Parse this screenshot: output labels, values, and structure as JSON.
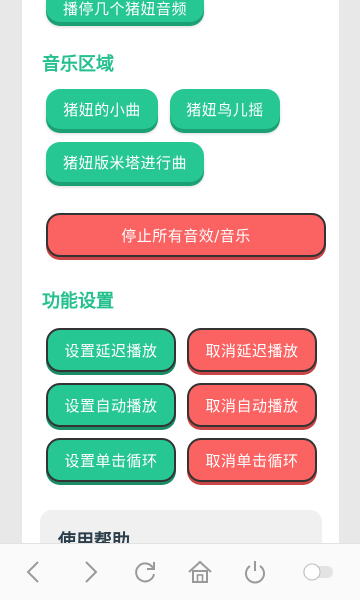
{
  "top_partial_button": {
    "label": "播停几个猪妞音频"
  },
  "music_section": {
    "title": "音乐区域",
    "buttons": [
      "猪妞的小曲",
      "猪妞鸟儿摇",
      "猪妞版米塔进行曲"
    ]
  },
  "stop_all": {
    "label": "停止所有音效/音乐"
  },
  "settings_section": {
    "title": "功能设置",
    "rows": [
      {
        "set": "设置延迟播放",
        "cancel": "取消延迟播放"
      },
      {
        "set": "设置自动播放",
        "cancel": "取消自动播放"
      },
      {
        "set": "设置单击循环",
        "cancel": "取消单击循环"
      }
    ]
  },
  "help": {
    "title": "使用帮助"
  },
  "nav_bar": {
    "icons": [
      "back-icon",
      "forward-icon",
      "refresh-icon",
      "home-icon",
      "power-icon",
      "toggle-switch"
    ]
  },
  "colors": {
    "accent_green": "#27c794",
    "danger_red": "#fb6262",
    "title_green": "#26c08f"
  }
}
